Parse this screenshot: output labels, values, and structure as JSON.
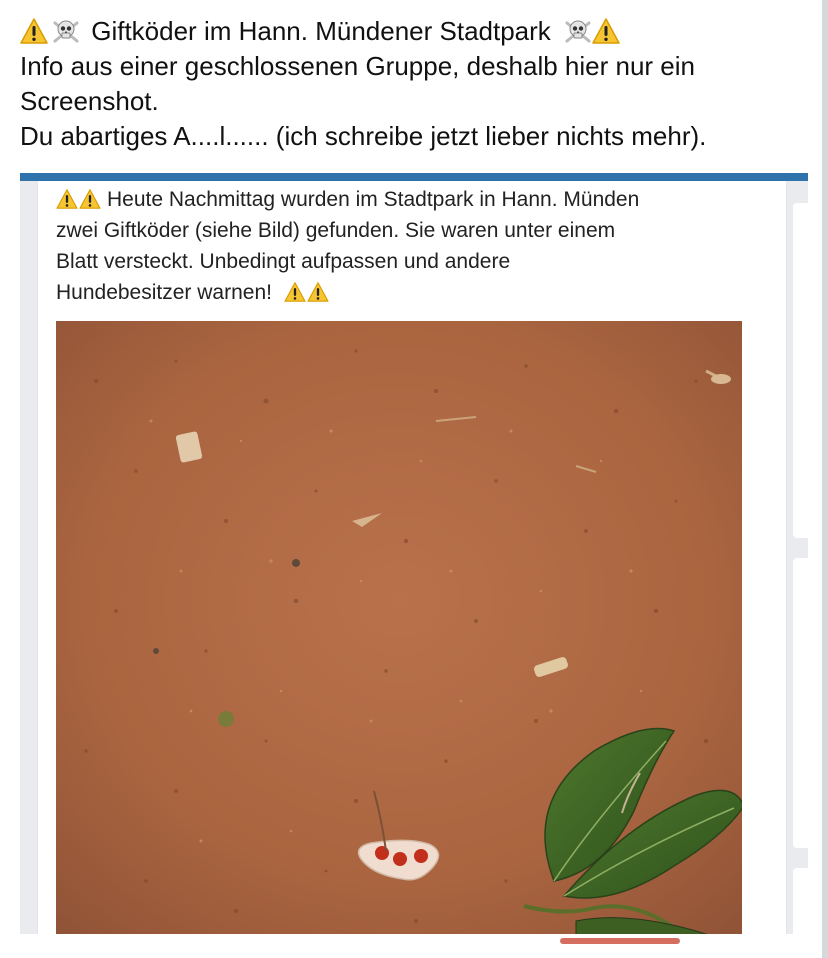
{
  "post": {
    "title": "Giftköder im Hann. Mündener Stadtpark",
    "line2": "Info aus einer geschlossenen Gruppe, deshalb hier nur ein",
    "line3": "Screenshot.",
    "line4": "Du abartiges A....l...... (ich schreibe jetzt lieber nichts mehr).",
    "title_icons": [
      "warning-icon",
      "skull-crossbones-icon"
    ]
  },
  "shared_screenshot": {
    "line1": "Heute Nachmittag wurden im Stadtpark in Hann. Münden",
    "line2": "zwei Giftköder (siehe Bild) gefunden. Sie waren unter einem",
    "line3": "Blatt versteckt. Unbedingt aufpassen und andere",
    "line4": "Hundebesitzer warnen!",
    "header_bar_color": "#2f73ad",
    "photo_subject": "poison bait on red sandy ground next to a green leaf"
  },
  "colors": {
    "text": "#111111",
    "warning_yellow": "#f7c531",
    "sand": "#b06a45"
  }
}
